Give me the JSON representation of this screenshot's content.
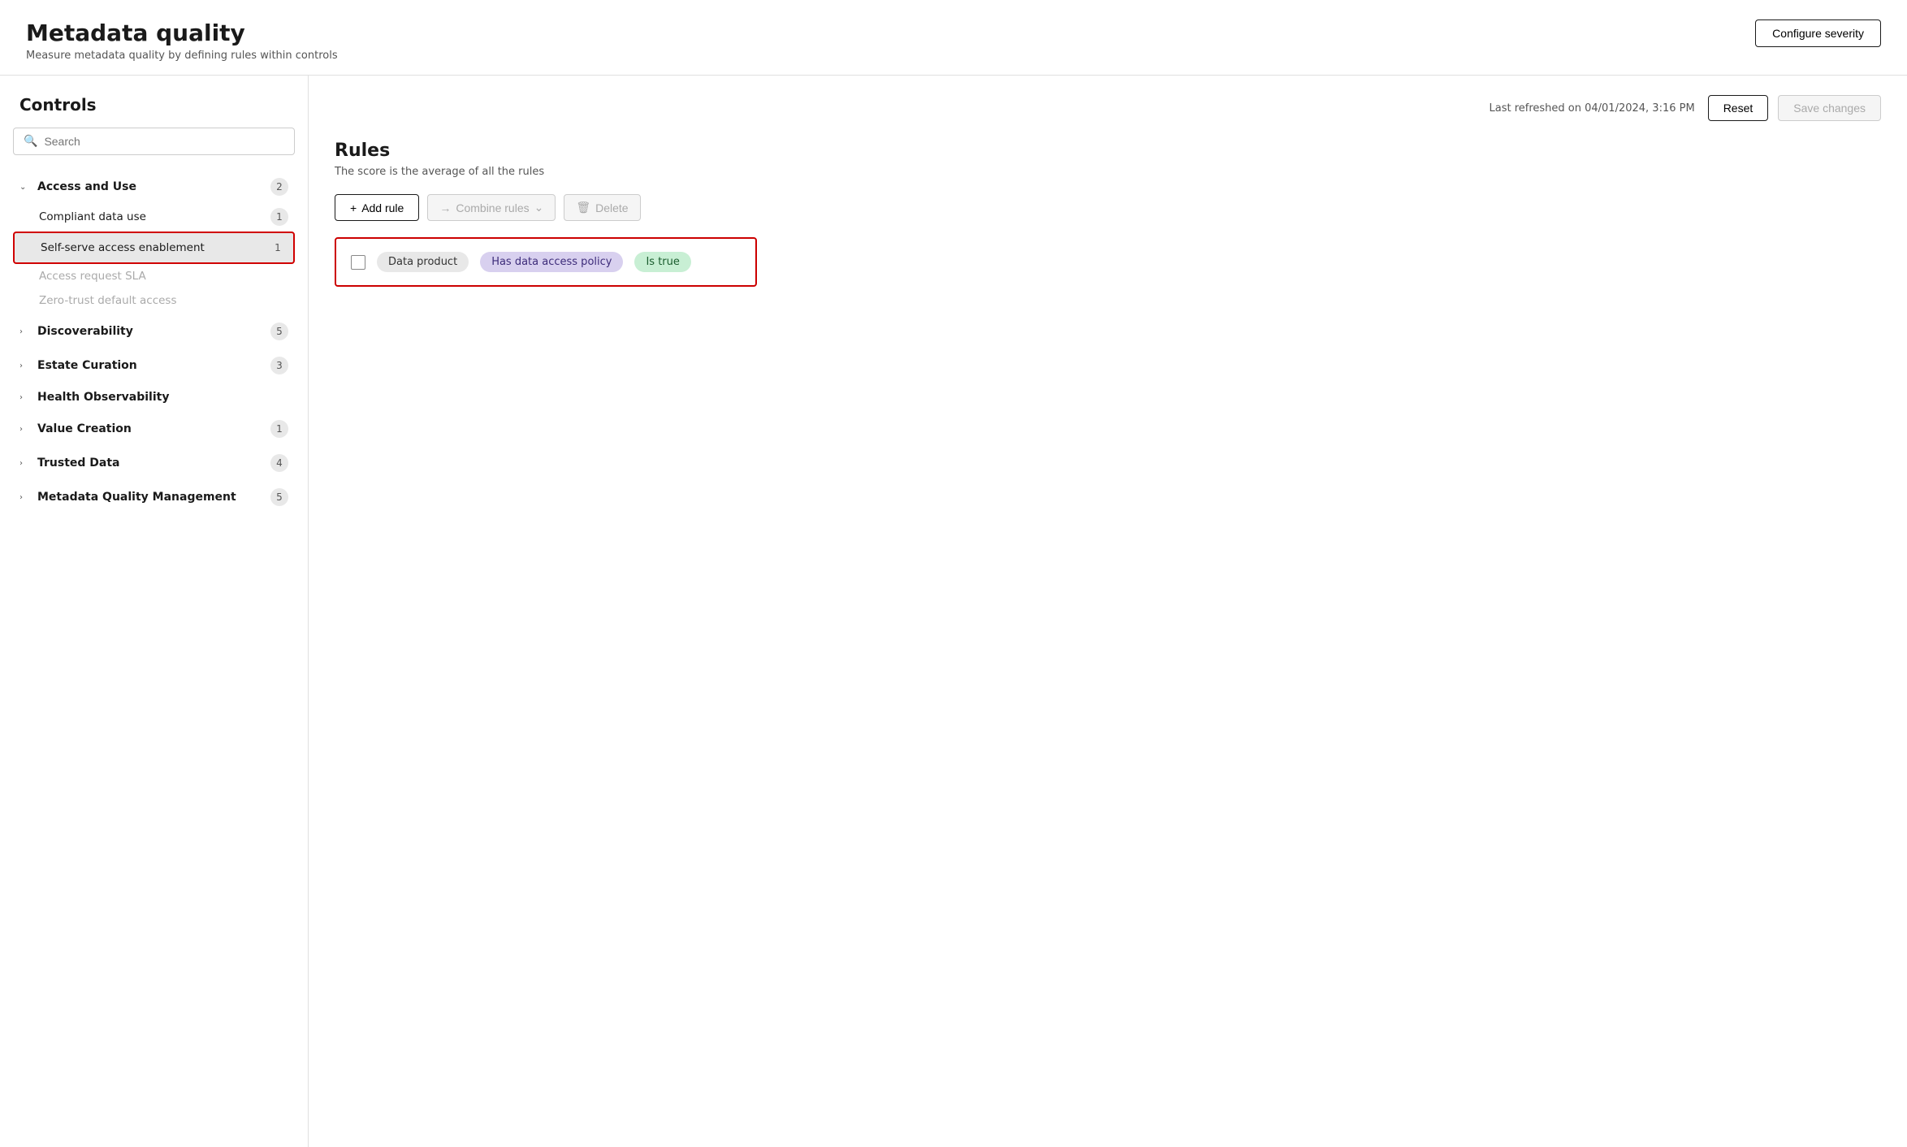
{
  "header": {
    "title": "Metadata quality",
    "subtitle": "Measure metadata quality by defining rules within controls",
    "configure_severity_label": "Configure severity"
  },
  "topbar": {
    "last_refreshed": "Last refreshed on 04/01/2024, 3:16 PM",
    "reset_label": "Reset",
    "save_changes_label": "Save changes"
  },
  "sidebar": {
    "title": "Controls",
    "search_placeholder": "Search",
    "groups": [
      {
        "id": "access-and-use",
        "label": "Access and Use",
        "count": "2",
        "expanded": true,
        "items": [
          {
            "id": "compliant-data-use",
            "label": "Compliant data use",
            "count": "1",
            "active": false,
            "disabled": false
          },
          {
            "id": "self-serve-access-enablement",
            "label": "Self-serve access enablement",
            "count": "1",
            "active": true,
            "disabled": false
          },
          {
            "id": "access-request-sla",
            "label": "Access request SLA",
            "count": null,
            "active": false,
            "disabled": true
          },
          {
            "id": "zero-trust-default-access",
            "label": "Zero-trust default access",
            "count": null,
            "active": false,
            "disabled": true
          }
        ]
      },
      {
        "id": "discoverability",
        "label": "Discoverability",
        "count": "5",
        "expanded": false,
        "items": []
      },
      {
        "id": "estate-curation",
        "label": "Estate Curation",
        "count": "3",
        "expanded": false,
        "items": []
      },
      {
        "id": "health-observability",
        "label": "Health Observability",
        "count": null,
        "expanded": false,
        "items": []
      },
      {
        "id": "value-creation",
        "label": "Value Creation",
        "count": "1",
        "expanded": false,
        "items": []
      },
      {
        "id": "trusted-data",
        "label": "Trusted Data",
        "count": "4",
        "expanded": false,
        "items": []
      },
      {
        "id": "metadata-quality-management",
        "label": "Metadata Quality Management",
        "count": "5",
        "expanded": false,
        "items": []
      }
    ]
  },
  "rules": {
    "title": "Rules",
    "subtitle": "The score is the average of all the rules",
    "add_rule_label": "Add rule",
    "combine_rules_label": "Combine rules",
    "delete_label": "Delete",
    "items": [
      {
        "id": "rule-1",
        "subject": "Data product",
        "condition": "Has data access policy",
        "value": "Is true"
      }
    ]
  }
}
